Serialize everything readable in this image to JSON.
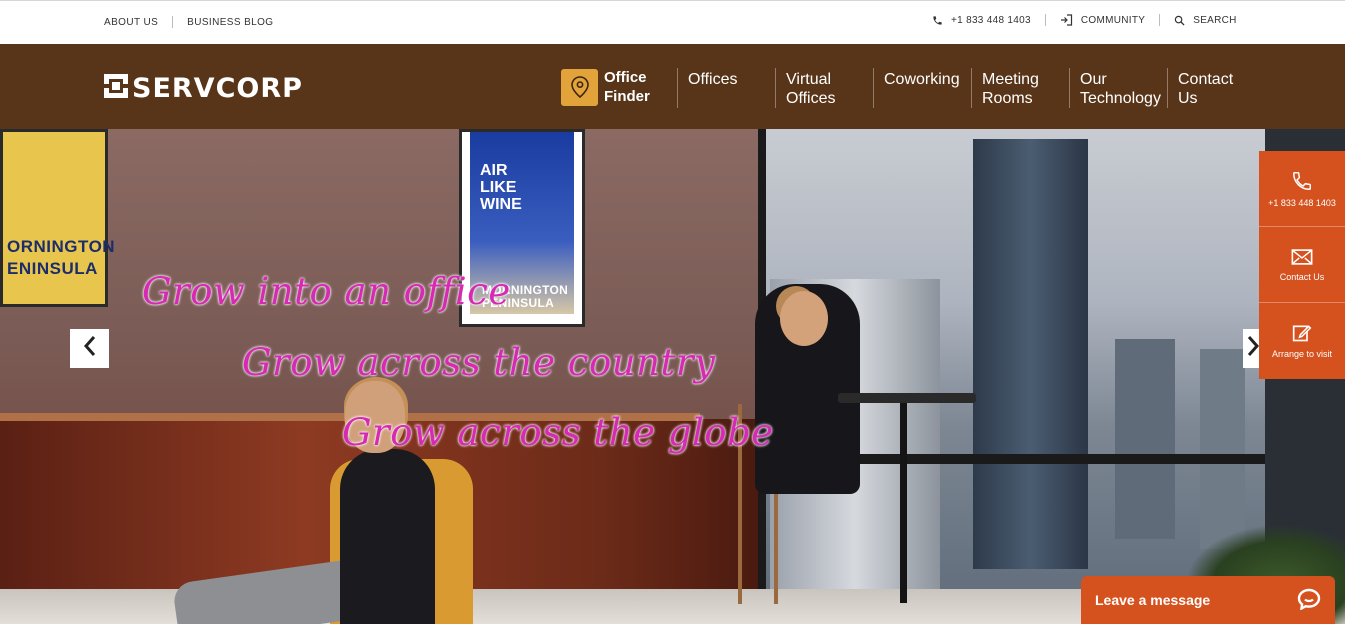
{
  "utility_bar": {
    "left_links": [
      "ABOUT US",
      "BUSINESS BLOG"
    ],
    "phone": "+1 833 448 1403",
    "community": "COMMUNITY",
    "search": "SEARCH"
  },
  "brand": {
    "name": "SERVCORP"
  },
  "nav": {
    "office_finder": "Office\nFinder",
    "items": [
      {
        "label": "Offices"
      },
      {
        "label": "Virtual\nOffices"
      },
      {
        "label": "Coworking"
      },
      {
        "label": "Meeting\nRooms"
      },
      {
        "label": "Our\nTechnology"
      },
      {
        "label": "Contact\nUs"
      }
    ]
  },
  "hero": {
    "slogans": [
      "Grow into an office",
      "Grow across the country",
      "Grow across the globe"
    ],
    "poster_left": "ORNINGTON\nENINSULA",
    "poster_right_top": "AIR\nLIKE\nWINE",
    "poster_right_bottom": "MORNINGTON\nPENINSULA"
  },
  "side_panel": {
    "phone": "+1 833 448 1403",
    "contact": "Contact Us",
    "visit": "Arrange to visit"
  },
  "chat": {
    "label": "Leave a message"
  },
  "colors": {
    "nav_bg": "#583518",
    "accent_orange": "#d5521f",
    "pin_gold": "#e2a43a",
    "slogan_pink": "#d62ab4"
  }
}
